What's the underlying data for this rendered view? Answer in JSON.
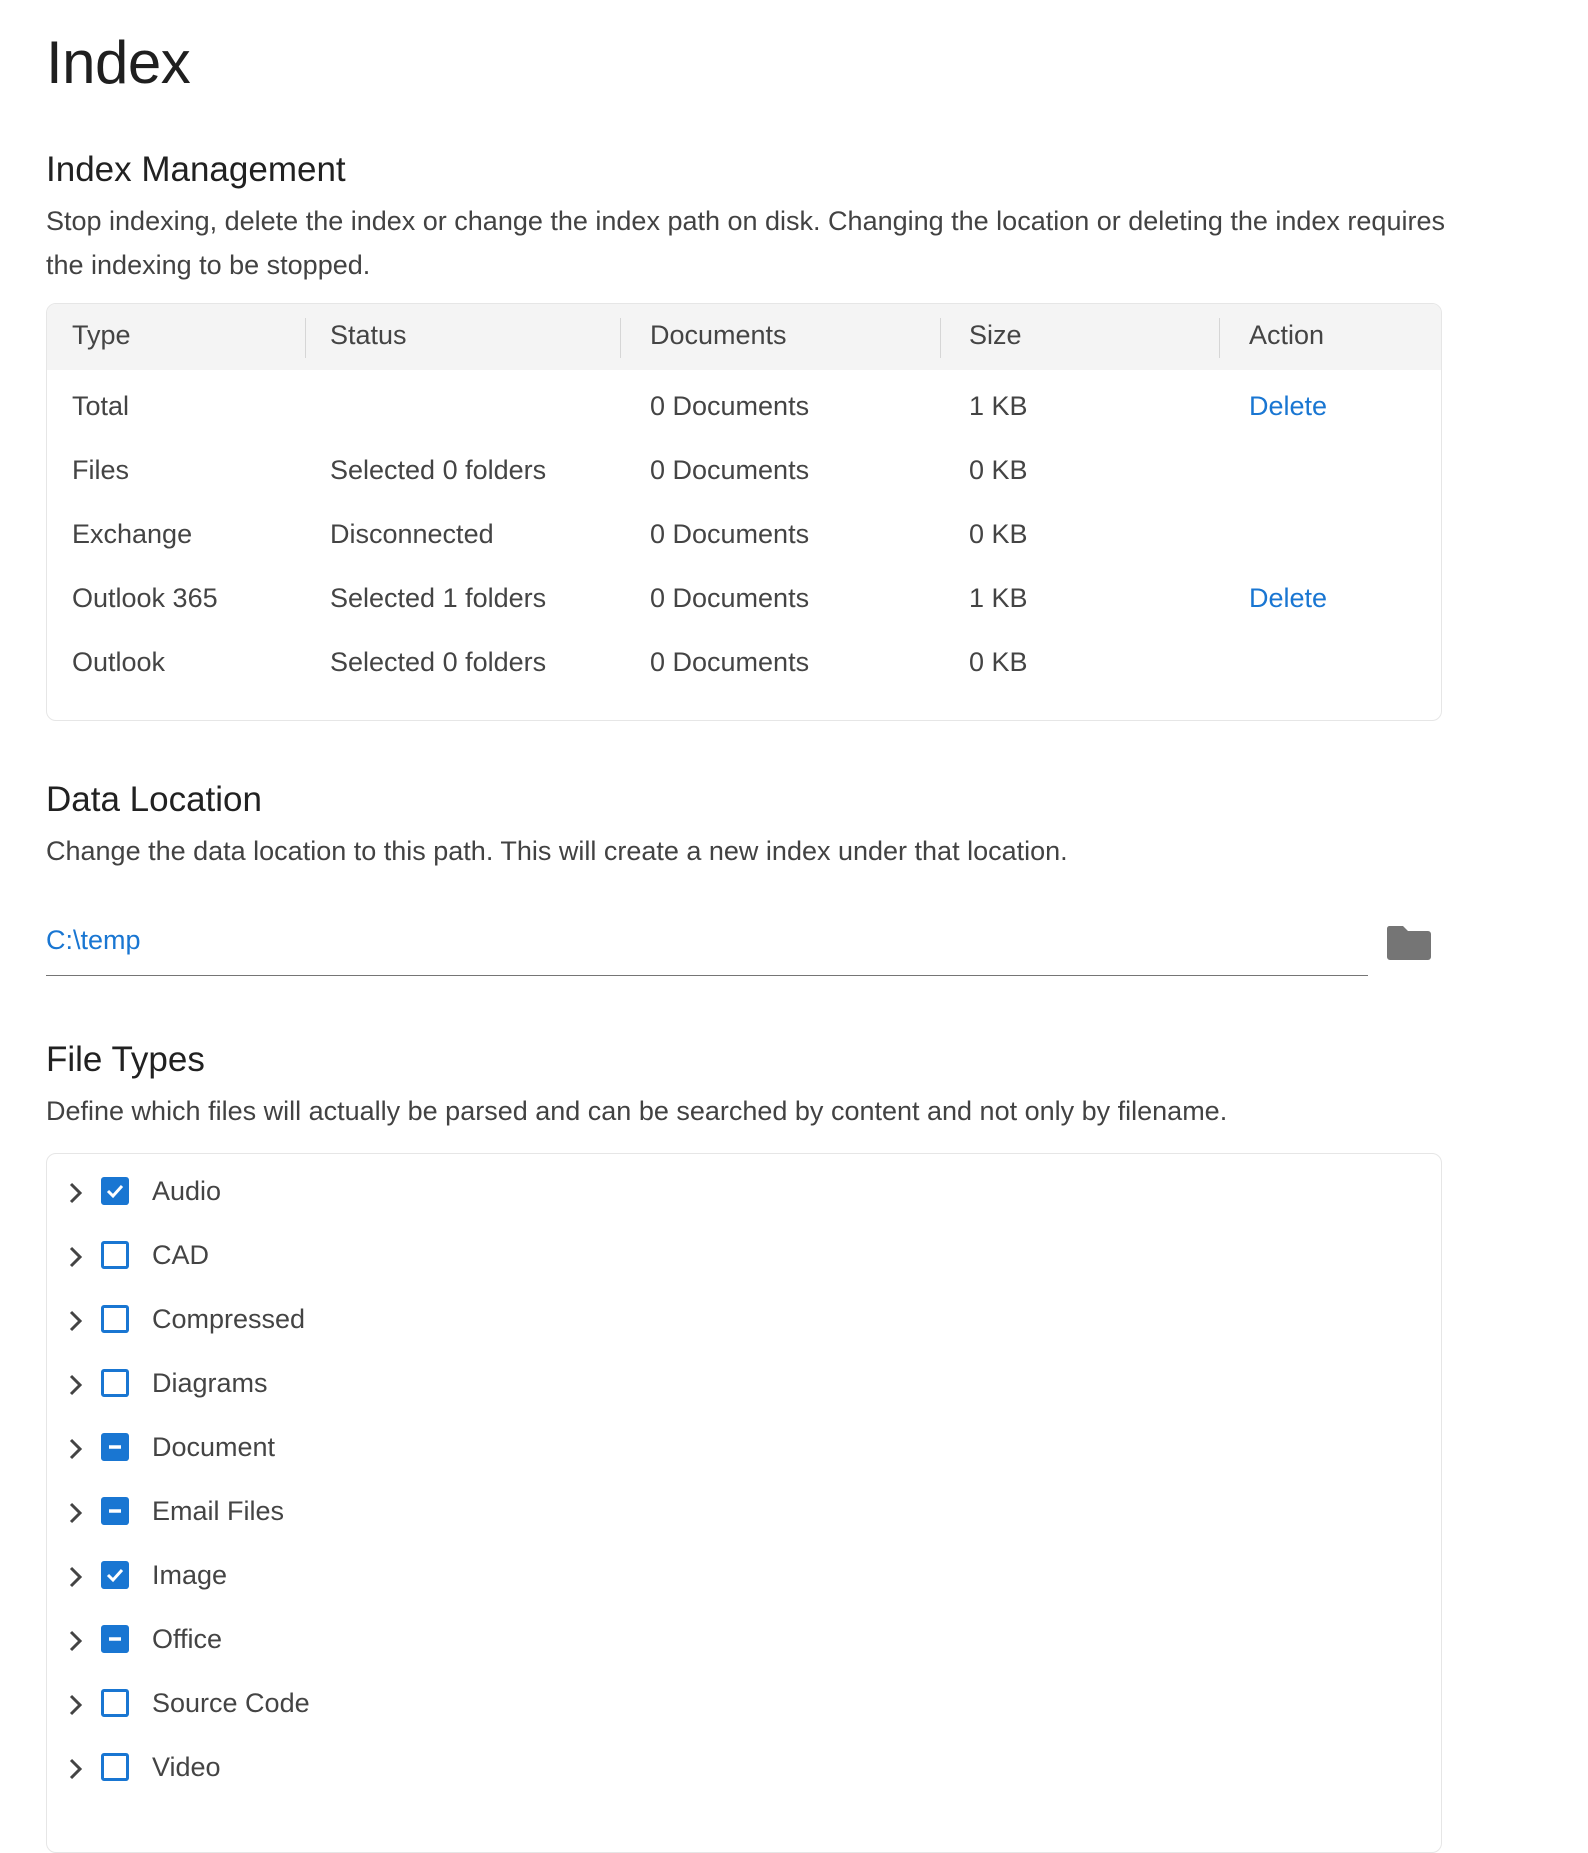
{
  "page": {
    "title": "Index"
  },
  "index_management": {
    "title": "Index Management",
    "description": "Stop indexing, delete the index or change the index path on disk. Changing the location or deleting the index requires the indexing to be stopped.",
    "columns": [
      "Type",
      "Status",
      "Documents",
      "Size",
      "Action"
    ],
    "rows": [
      {
        "type": "Total",
        "status": "",
        "documents": "0 Documents",
        "size": "1 KB",
        "action": "Delete"
      },
      {
        "type": "Files",
        "status": "Selected 0 folders",
        "documents": "0 Documents",
        "size": "0 KB",
        "action": ""
      },
      {
        "type": "Exchange",
        "status": "Disconnected",
        "documents": "0 Documents",
        "size": "0 KB",
        "action": ""
      },
      {
        "type": "Outlook 365",
        "status": "Selected 1 folders",
        "documents": "0 Documents",
        "size": "1 KB",
        "action": "Delete"
      },
      {
        "type": "Outlook",
        "status": "Selected 0 folders",
        "documents": "0 Documents",
        "size": "0 KB",
        "action": ""
      }
    ]
  },
  "data_location": {
    "title": "Data Location",
    "description": "Change the data location to this path. This will create a new index under that location.",
    "path": "C:\\temp",
    "browse_icon": "folder-icon"
  },
  "file_types": {
    "title": "File Types",
    "description": "Define which files will actually be parsed and can be searched by content and not only by filename.",
    "items": [
      {
        "label": "Audio",
        "state": "checked"
      },
      {
        "label": "CAD",
        "state": "unchecked"
      },
      {
        "label": "Compressed",
        "state": "unchecked"
      },
      {
        "label": "Diagrams",
        "state": "unchecked"
      },
      {
        "label": "Document",
        "state": "partial"
      },
      {
        "label": "Email Files",
        "state": "partial"
      },
      {
        "label": "Image",
        "state": "checked"
      },
      {
        "label": "Office",
        "state": "partial"
      },
      {
        "label": "Source Code",
        "state": "unchecked"
      },
      {
        "label": "Video",
        "state": "unchecked"
      }
    ]
  },
  "colors": {
    "accent": "#1976d2",
    "header_bg": "#f4f4f4",
    "icon_gray": "#757575"
  }
}
